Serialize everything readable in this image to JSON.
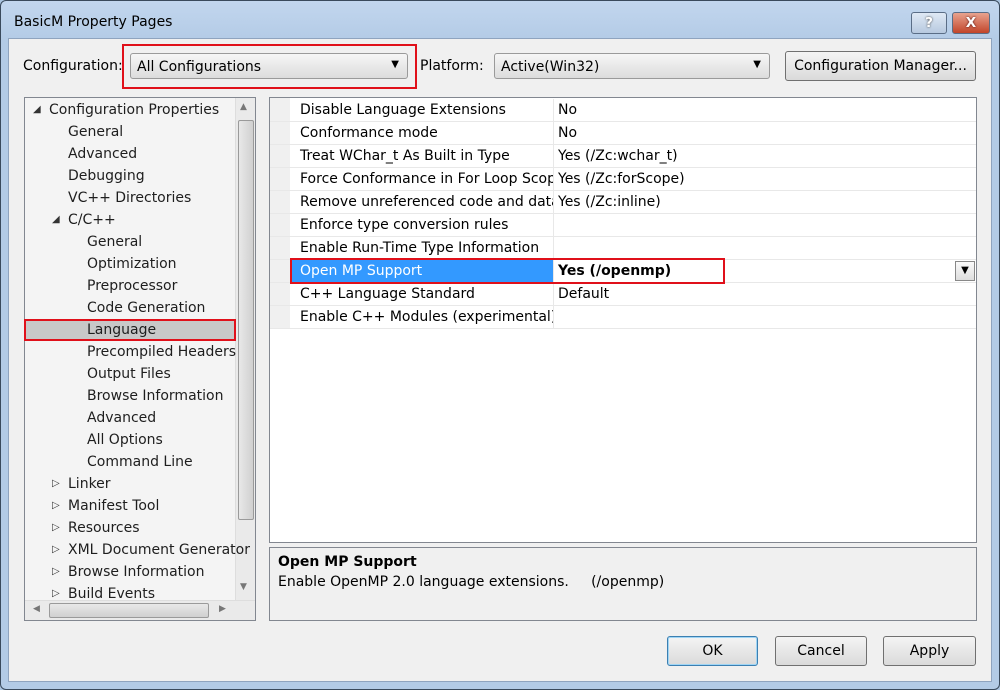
{
  "window": {
    "title": "BasicM Property Pages",
    "help_label": "?",
    "close_label": "X"
  },
  "toolbar": {
    "configuration_label": "Configuration:",
    "configuration_value": "All Configurations",
    "platform_label": "Platform:",
    "platform_value": "Active(Win32)",
    "config_manager_label": "Configuration Manager..."
  },
  "tree": {
    "items": [
      {
        "label": "Configuration Properties",
        "level": 0,
        "toggle": "expanded"
      },
      {
        "label": "General",
        "level": 1
      },
      {
        "label": "Advanced",
        "level": 1
      },
      {
        "label": "Debugging",
        "level": 1
      },
      {
        "label": "VC++ Directories",
        "level": 1
      },
      {
        "label": "C/C++",
        "level": 1,
        "toggle": "expanded"
      },
      {
        "label": "General",
        "level": 2
      },
      {
        "label": "Optimization",
        "level": 2
      },
      {
        "label": "Preprocessor",
        "level": 2
      },
      {
        "label": "Code Generation",
        "level": 2
      },
      {
        "label": "Language",
        "level": 2,
        "selected": true
      },
      {
        "label": "Precompiled Headers",
        "level": 2
      },
      {
        "label": "Output Files",
        "level": 2
      },
      {
        "label": "Browse Information",
        "level": 2
      },
      {
        "label": "Advanced",
        "level": 2
      },
      {
        "label": "All Options",
        "level": 2
      },
      {
        "label": "Command Line",
        "level": 2
      },
      {
        "label": "Linker",
        "level": 1,
        "toggle": "collapsed"
      },
      {
        "label": "Manifest Tool",
        "level": 1,
        "toggle": "collapsed"
      },
      {
        "label": "Resources",
        "level": 1,
        "toggle": "collapsed"
      },
      {
        "label": "XML Document Generator",
        "level": 1,
        "toggle": "collapsed"
      },
      {
        "label": "Browse Information",
        "level": 1,
        "toggle": "collapsed"
      },
      {
        "label": "Build Events",
        "level": 1,
        "toggle": "collapsed"
      }
    ]
  },
  "grid": {
    "rows": [
      {
        "name": "Disable Language Extensions",
        "value": "No"
      },
      {
        "name": "Conformance mode",
        "value": "No"
      },
      {
        "name": "Treat WChar_t As Built in Type",
        "value": "Yes (/Zc:wchar_t)"
      },
      {
        "name": "Force Conformance in For Loop Scope",
        "value": "Yes (/Zc:forScope)"
      },
      {
        "name": "Remove unreferenced code and data",
        "value": "Yes (/Zc:inline)"
      },
      {
        "name": "Enforce type conversion rules",
        "value": ""
      },
      {
        "name": "Enable Run-Time Type Information",
        "value": ""
      },
      {
        "name": "Open MP Support",
        "value": "Yes (/openmp)",
        "selected": true
      },
      {
        "name": "C++ Language Standard",
        "value": "Default"
      },
      {
        "name": "Enable C++ Modules (experimental)",
        "value": ""
      }
    ]
  },
  "description": {
    "title": "Open MP Support",
    "text": "Enable OpenMP 2.0 language extensions.     (/openmp)"
  },
  "buttons": {
    "ok": "OK",
    "cancel": "Cancel",
    "apply": "Apply"
  },
  "colors": {
    "selection": "#3399ff",
    "highlight_box": "#e0101a",
    "tree_selection": "#c8c8c8"
  }
}
